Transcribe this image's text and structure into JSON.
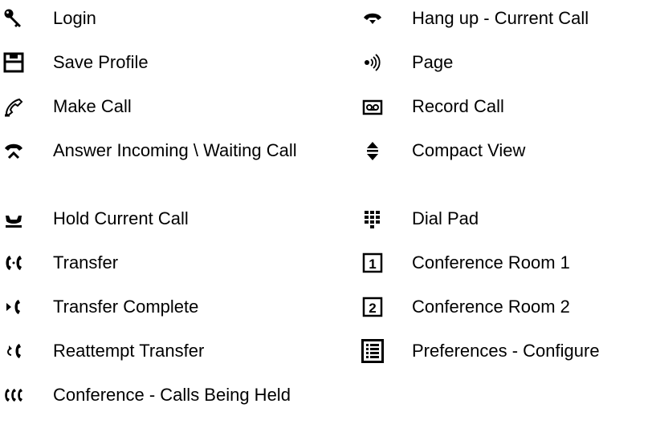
{
  "legend": {
    "left": [
      {
        "icon": "key-icon",
        "label": "Login"
      },
      {
        "icon": "floppy-disk-icon",
        "label": "Save Profile"
      },
      {
        "icon": "handset-dial-icon",
        "label": "Make Call"
      },
      {
        "icon": "answer-call-icon",
        "label": "Answer Incoming \\ Waiting Call"
      },
      {
        "icon": "hold-call-icon",
        "label": "Hold Current Call"
      },
      {
        "icon": "transfer-icon",
        "label": "Transfer"
      },
      {
        "icon": "transfer-complete-icon",
        "label": "Transfer Complete"
      },
      {
        "icon": "reattempt-transfer-icon",
        "label": "Reattempt Transfer"
      },
      {
        "icon": "conference-held-icon",
        "label": "Conference - Calls Being Held"
      }
    ],
    "right": [
      {
        "icon": "hang-up-icon",
        "label": "Hang up - Current Call"
      },
      {
        "icon": "page-speaker-icon",
        "label": "Page"
      },
      {
        "icon": "record-call-icon",
        "label": "Record Call"
      },
      {
        "icon": "compact-view-icon",
        "label": "Compact View"
      },
      {
        "icon": "dial-pad-icon",
        "label": "Dial Pad"
      },
      {
        "icon": "conference-room-1-icon",
        "label": "Conference Room 1",
        "badge": "1"
      },
      {
        "icon": "conference-room-2-icon",
        "label": "Conference Room 2",
        "badge": "2"
      },
      {
        "icon": "preferences-icon",
        "label": "Preferences - Configure"
      }
    ]
  }
}
